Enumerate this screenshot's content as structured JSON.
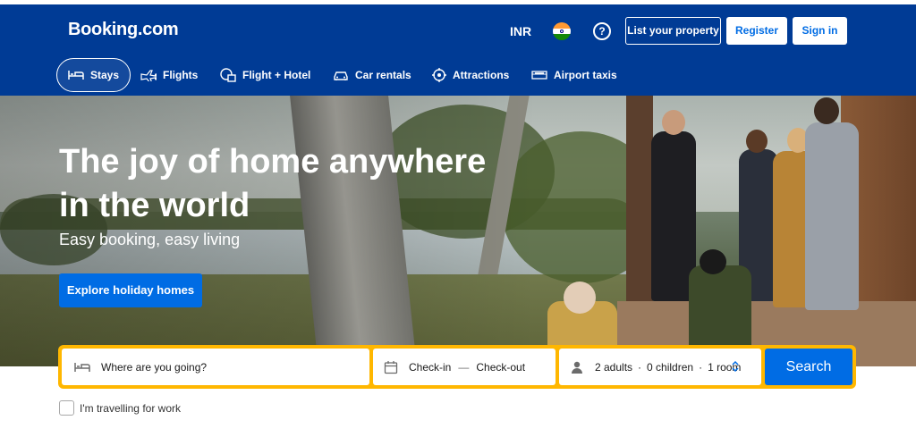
{
  "header": {
    "logo": "Booking.com",
    "currency": "INR",
    "help_symbol": "?",
    "list_property": "List your property",
    "register": "Register",
    "sign_in": "Sign in",
    "background_color": "#003b95"
  },
  "nav": {
    "items": [
      {
        "label": "Stays",
        "icon": "bed-icon",
        "active": true
      },
      {
        "label": "Flights",
        "icon": "plane-icon"
      },
      {
        "label": "Flight + Hotel",
        "icon": "flight-hotel-icon"
      },
      {
        "label": "Car rentals",
        "icon": "car-icon"
      },
      {
        "label": "Attractions",
        "icon": "attractions-icon"
      },
      {
        "label": "Airport taxis",
        "icon": "taxi-icon"
      }
    ]
  },
  "hero": {
    "title": "The joy of home anywhere in the world",
    "subtitle": "Easy booking, easy living",
    "cta": "Explore holiday homes"
  },
  "search": {
    "destination_placeholder": "Where are you going?",
    "check_in": "Check-in",
    "dash": "—",
    "check_out": "Check-out",
    "adults": "2 adults",
    "children": "0 children",
    "rooms": "1 room",
    "separator": "·",
    "search_button": "Search",
    "accent_color": "#ffb700",
    "button_color": "#006ce4"
  },
  "work_travel": {
    "label": "I'm travelling for work",
    "checked": false
  }
}
